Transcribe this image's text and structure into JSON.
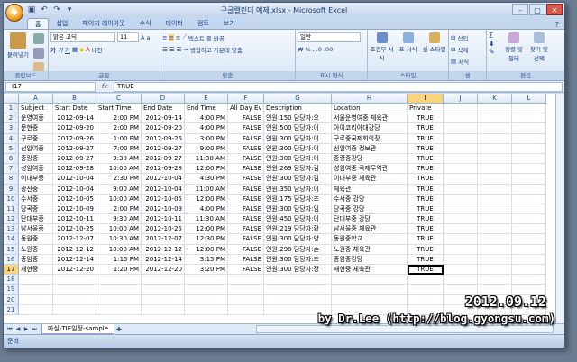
{
  "window": {
    "title": "구글캘린더 예제.xlsx - Microsoft Excel"
  },
  "ribbon": {
    "tabs": [
      "홈",
      "삽입",
      "페이지 레이아웃",
      "수식",
      "데이터",
      "검토",
      "보기"
    ],
    "groups": {
      "clipboard": "클립보드",
      "font": "글꼴",
      "alignment": "맞춤",
      "number": "표시 형식",
      "styles": "스타일",
      "cells": "셀",
      "editing": "편집"
    },
    "paste_label": "붙여넣기",
    "font_name": "맑은 고딕",
    "font_size": "11",
    "wrap_text": "텍스트 줄 바꿈",
    "merge_center": "병합하고 가운데 맞춤",
    "number_format": "일반",
    "cond_format": "조건부 서식",
    "table_format": "표 서식",
    "cell_style": "셀 스타일",
    "insert": "삽입",
    "delete": "삭제",
    "format": "서식",
    "sort_filter": "정렬 및 필터",
    "find_select": "찾기 및 선택"
  },
  "formula_bar": {
    "name_box": "I17",
    "fx": "fx",
    "value": "TRUE"
  },
  "columns": [
    "A",
    "B",
    "C",
    "D",
    "E",
    "F",
    "G",
    "H",
    "I",
    "J",
    "K",
    "L"
  ],
  "header_row": [
    "Subject",
    "Start Date",
    "Start Time",
    "End Date",
    "End Time",
    "All Day Ev",
    "Description",
    "Location",
    "Private",
    "",
    "",
    ""
  ],
  "rows": [
    [
      "운영여중",
      "2012-09-14",
      "2:00 PM",
      "2012-09-14",
      "4:00 PM",
      "FALSE",
      "인원:150 담당자:오",
      "서울운영여중 체육관",
      "TRUE"
    ],
    [
      "문현중",
      "2012-09-20",
      "2:00 PM",
      "2012-09-20",
      "4:00 PM",
      "FALSE",
      "인원:500 담당자:이",
      "아이코리아대강당",
      "TRUE"
    ],
    [
      "구로중",
      "2012-09-26",
      "1:00 PM",
      "2012-09-26",
      "3:00 PM",
      "FALSE",
      "인원:300 담당자:이",
      "구로중국제회의장",
      "TRUE"
    ],
    [
      "선일여중",
      "2012-09-27",
      "7:00 PM",
      "2012-09-27",
      "9:00 PM",
      "FALSE",
      "인원:300 담당자:이",
      "선일여중 정보관",
      "TRUE"
    ],
    [
      "중랑중",
      "2012-09-27",
      "9:30 AM",
      "2012-09-27",
      "11:30 AM",
      "FALSE",
      "인원:300 담당자:이",
      "중랑중강당",
      "TRUE"
    ],
    [
      "성암여중",
      "2012-09-28",
      "10:00 AM",
      "2012-09-28",
      "12:00 PM",
      "FALSE",
      "인원:269 담당자:김",
      "성암여중 국제무역관",
      "TRUE"
    ],
    [
      "이대부중",
      "2012-10-04",
      "2:30 PM",
      "2012-10-04",
      "4:30 PM",
      "FALSE",
      "인원:300 담당자:김",
      "이대부중 체육관",
      "TRUE"
    ],
    [
      "광신중",
      "2012-10-04",
      "9:00 AM",
      "2012-10-04",
      "11:00 AM",
      "FALSE",
      "인원:350 담당자:이",
      "체육관",
      "TRUE"
    ],
    [
      "수서중",
      "2012-10-05",
      "10:00 AM",
      "2012-10-05",
      "12:00 PM",
      "FALSE",
      "인원:175 담당자:조",
      "수서중 강당",
      "TRUE"
    ],
    [
      "당곡중",
      "2012-10-09",
      "2:00 PM",
      "2012-10-09",
      "4:00 PM",
      "FALSE",
      "인원:300 담당자:임",
      "당곡중 강당",
      "TRUE"
    ],
    [
      "단대부중",
      "2012-10-11",
      "9:30 AM",
      "2012-10-11",
      "11:30 AM",
      "FALSE",
      "인원:450 담당자:이",
      "단대부중 강당",
      "TRUE"
    ],
    [
      "남서울중",
      "2012-10-25",
      "10:00 AM",
      "2012-10-25",
      "12:00 PM",
      "FALSE",
      "인원:219 담당자:황",
      "남서울중 체육관",
      "TRUE"
    ],
    [
      "동원중",
      "2012-12-07",
      "10:30 AM",
      "2012-12-07",
      "12:30 PM",
      "FALSE",
      "인원:300 담당자:양",
      "동원중학교",
      "TRUE"
    ],
    [
      "노원중",
      "2012-12-12",
      "10:00 AM",
      "2012-12-12",
      "12:00 PM",
      "FALSE",
      "인원:298 담당자:손",
      "노원중 체육관",
      "TRUE"
    ],
    [
      "종암중",
      "2012-12-14",
      "1:15 PM",
      "2012-12-14",
      "3:15 PM",
      "FALSE",
      "인원:300 담당자:조",
      "종암중강당",
      "TRUE"
    ],
    [
      "재현중",
      "2012-12-20",
      "1:20 PM",
      "2012-12-20",
      "3:20 PM",
      "FALSE",
      "인원:300 담당자:장",
      "재현중 체육관",
      "TRUE"
    ]
  ],
  "row_numbers": [
    "1",
    "2",
    "3",
    "4",
    "5",
    "6",
    "7",
    "8",
    "9",
    "10",
    "11",
    "12",
    "13",
    "14",
    "15",
    "16",
    "17",
    "18",
    "19",
    "20",
    "21"
  ],
  "sheet_tab": "마실-TIE일정-sample",
  "status": "준비",
  "watermark": {
    "date": "2012.09.12",
    "credit": "by Dr.Lee (http://blog.gyongsu.com)"
  }
}
